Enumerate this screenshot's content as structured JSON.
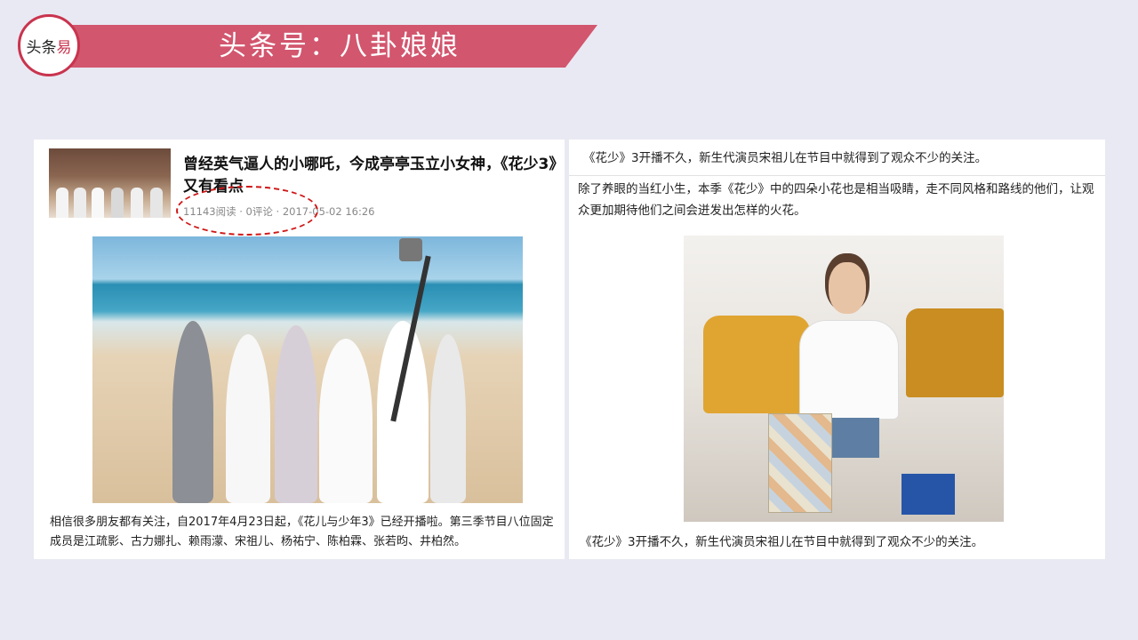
{
  "header": {
    "logo": {
      "part1": "头条",
      "part2": "易"
    },
    "title": "头条号：八卦娘娘",
    "banner_color": "#d2566e"
  },
  "left_article": {
    "title": "曾经英气逼人的小哪吒，今成亭亭玉立小女神，《花少3》又有看点",
    "meta": "11143阅读 · 0评论 · 2017-05-02 16:26",
    "body": "相信很多朋友都有关注，自2017年4月23日起，《花儿与少年3》已经开播啦。第三季节目八位固定成员是江疏影、古力娜扎、赖雨濛、宋祖儿、杨祐宁、陈柏霖、张若昀、井柏然。"
  },
  "right_article": {
    "caption_top": "《花少》3开播不久，新生代演员宋祖儿在节目中就得到了观众不少的关注。",
    "paragraph": "除了养眼的当红小生，本季《花少》中的四朵小花也是相当吸睛，走不同风格和路线的他们，让观众更加期待他们之间会迸发出怎样的火花。",
    "caption_bottom": "《花少》3开播不久，新生代演员宋祖儿在节目中就得到了观众不少的关注。"
  },
  "colors": {
    "background": "#e9e9f3",
    "accent": "#c9344e",
    "annotation": "#d01818"
  }
}
